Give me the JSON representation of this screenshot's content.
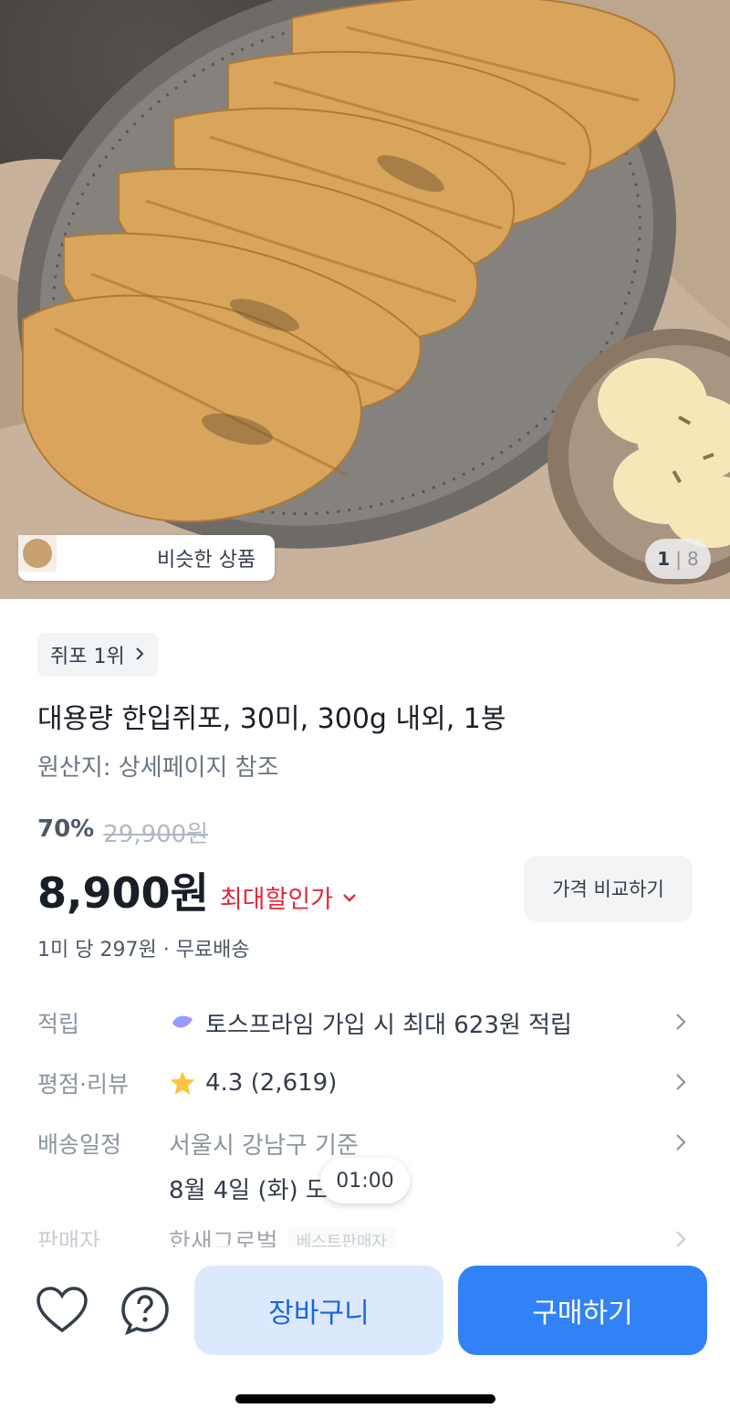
{
  "gallery": {
    "similar_label": "비슷한 상품",
    "page_current": "1",
    "page_separator": "|",
    "page_total": "8"
  },
  "product": {
    "rank_chip": "쥐포 1위",
    "title": "대용량 한입쥐포, 30미, 300g 내외, 1봉",
    "origin": "원산지: 상세페이지 참조",
    "discount_percent": "70%",
    "original_price": "29,900원",
    "price": "8,900원",
    "max_discount_label": "최대할인가",
    "compare_button": "가격 비교하기",
    "unit_price": "1미 당 297원 · 무료배송"
  },
  "details": {
    "points_label": "적립",
    "points_value": "토스프라임 가입 시 최대 623원 적립",
    "rating_label": "평점·리뷰",
    "rating_value": "4.3 (2,619)",
    "shipping_label": "배송일정",
    "shipping_line1": "서울시 강남구 기준",
    "shipping_line2": "8월 4일 (화) 도",
    "seller_label": "판매자",
    "seller_value": "한새그로벌",
    "seller_badge": "베스트판매자"
  },
  "timer": "01:00",
  "bottom_bar": {
    "cart_label": "장바구니",
    "buy_label": "구매하기"
  },
  "colors": {
    "primary": "#3182f6",
    "primary_light": "#dce9fd",
    "discount_red": "#e42939",
    "star": "#ffc342"
  },
  "icons": [
    "heart-icon",
    "question-icon",
    "chevron-right-icon",
    "chevron-down-icon",
    "star-icon",
    "toss-prime-icon"
  ]
}
